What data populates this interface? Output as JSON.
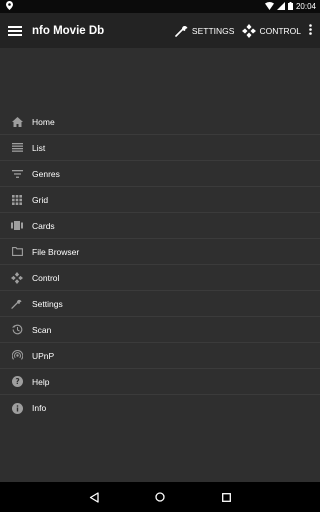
{
  "status": {
    "time": "20:04"
  },
  "appbar": {
    "title": "nfo Movie Db",
    "settings_label": "SETTINGS",
    "control_label": "CONTROL"
  },
  "menu": {
    "items": [
      {
        "label": "Home",
        "icon": "home-icon"
      },
      {
        "label": "List",
        "icon": "list-icon"
      },
      {
        "label": "Genres",
        "icon": "filter-icon"
      },
      {
        "label": "Grid",
        "icon": "grid-icon"
      },
      {
        "label": "Cards",
        "icon": "cards-icon"
      },
      {
        "label": "File Browser",
        "icon": "folder-icon"
      },
      {
        "label": "Control",
        "icon": "gamepad-icon"
      },
      {
        "label": "Settings",
        "icon": "wrench-icon"
      },
      {
        "label": "Scan",
        "icon": "history-icon"
      },
      {
        "label": "UPnP",
        "icon": "wifi-tethering-icon"
      },
      {
        "label": "Help",
        "icon": "help-icon"
      },
      {
        "label": "Info",
        "icon": "info-icon"
      }
    ]
  },
  "colors": {
    "appbar": "#232323",
    "background": "#2f2f2f",
    "statusbar": "#0b0b0b",
    "navbar": "#000000",
    "icon": "#9e9e9e"
  }
}
